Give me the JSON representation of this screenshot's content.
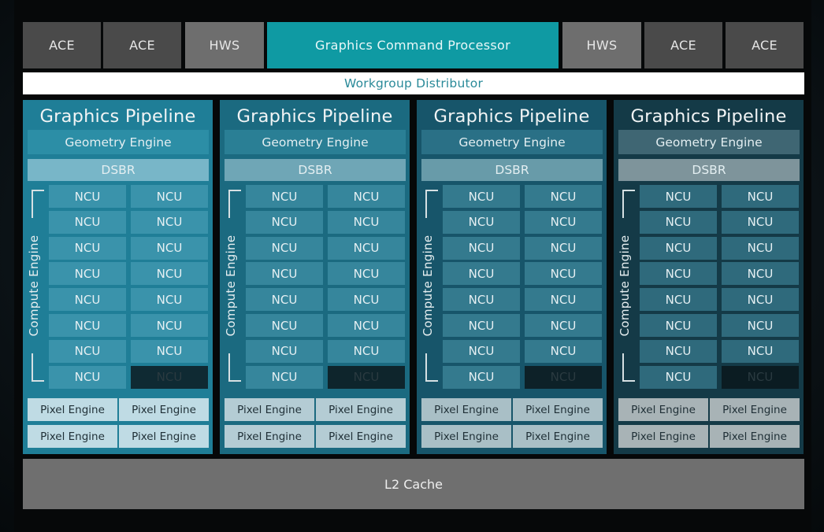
{
  "top_row": [
    {
      "label": "ACE",
      "kind": "ace"
    },
    {
      "label": "ACE",
      "kind": "ace"
    },
    {
      "label": "HWS",
      "kind": "hws"
    },
    {
      "label": "Graphics Command Processor",
      "kind": "gcp"
    },
    {
      "label": "HWS",
      "kind": "hws"
    },
    {
      "label": "ACE",
      "kind": "ace"
    },
    {
      "label": "ACE",
      "kind": "ace"
    }
  ],
  "workgroup_distributor": "Workgroup Distributor",
  "pipelines": [
    {
      "title": "Graphics Pipeline",
      "geometry": "Geometry Engine",
      "dsbr": "DSBR",
      "compute_label": "Compute Engine",
      "ncu_label": "NCU",
      "ncu_active": [
        true,
        true,
        true,
        true,
        true,
        true,
        true,
        true,
        true,
        true,
        true,
        true,
        true,
        true,
        true,
        false
      ],
      "pixel_engines": [
        "Pixel Engine",
        "Pixel Engine",
        "Pixel Engine",
        "Pixel Engine"
      ],
      "colors": {
        "bg": "#1f7e97",
        "geo": "#2c8ea6",
        "dsbr": "#78b6c8",
        "ncu": "#3a93ab",
        "ncu_off": "#0f2a33",
        "pix": "#bfdbe4"
      }
    },
    {
      "title": "Graphics Pipeline",
      "geometry": "Geometry Engine",
      "dsbr": "DSBR",
      "compute_label": "Compute Engine",
      "ncu_label": "NCU",
      "ncu_active": [
        true,
        true,
        true,
        true,
        true,
        true,
        true,
        true,
        true,
        true,
        true,
        true,
        true,
        true,
        true,
        false
      ],
      "pixel_engines": [
        "Pixel Engine",
        "Pixel Engine",
        "Pixel Engine",
        "Pixel Engine"
      ],
      "colors": {
        "bg": "#1b6a80",
        "geo": "#2a7f95",
        "dsbr": "#6fa6b6",
        "ncu": "#36869c",
        "ncu_off": "#0e252c",
        "pix": "#b4ccd4"
      }
    },
    {
      "title": "Graphics Pipeline",
      "geometry": "Geometry Engine",
      "dsbr": "DSBR",
      "compute_label": "Compute Engine",
      "ncu_label": "NCU",
      "ncu_active": [
        true,
        true,
        true,
        true,
        true,
        true,
        true,
        true,
        true,
        true,
        true,
        true,
        true,
        true,
        true,
        false
      ],
      "pixel_engines": [
        "Pixel Engine",
        "Pixel Engine",
        "Pixel Engine",
        "Pixel Engine"
      ],
      "colors": {
        "bg": "#17556a",
        "geo": "#2a7086",
        "dsbr": "#689ba9",
        "ncu": "#347a8e",
        "ncu_off": "#0d2128",
        "pix": "#a9bfc6"
      }
    },
    {
      "title": "Graphics Pipeline",
      "geometry": "Geometry Engine",
      "dsbr": "DSBR",
      "compute_label": "Compute Engine",
      "ncu_label": "NCU",
      "ncu_active": [
        true,
        true,
        true,
        true,
        true,
        true,
        true,
        true,
        true,
        true,
        true,
        true,
        true,
        true,
        true,
        false
      ],
      "pixel_engines": [
        "Pixel Engine",
        "Pixel Engine",
        "Pixel Engine",
        "Pixel Engine"
      ],
      "colors": {
        "bg": "#143a47",
        "geo": "#3f6673",
        "dsbr": "#7e949b",
        "ncu": "#2f6a7c",
        "ncu_off": "#0b1c22",
        "pix": "#a8b3b6"
      }
    }
  ],
  "l2_cache": "L2 Cache"
}
